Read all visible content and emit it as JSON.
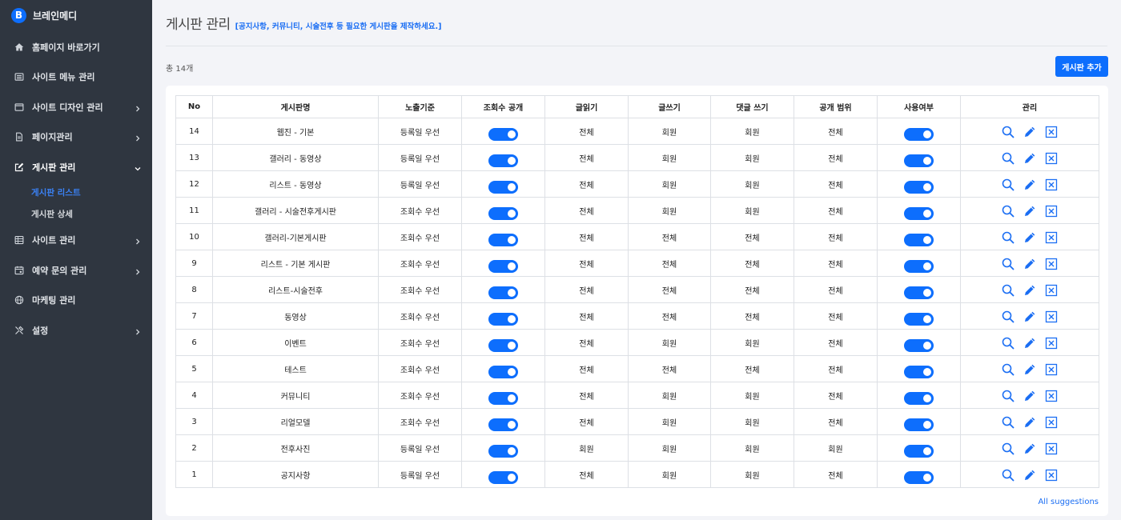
{
  "brand": {
    "logo_letter": "B",
    "name": "브레인메디"
  },
  "sidebar": {
    "items": [
      {
        "label": "홈페이지 바로가기",
        "icon": "home-icon",
        "chevron": false
      },
      {
        "label": "사이트 메뉴 관리",
        "icon": "list-icon",
        "chevron": false
      },
      {
        "label": "사이트 디자인 관리",
        "icon": "window-icon",
        "chevron": true
      },
      {
        "label": "페이지관리",
        "icon": "document-icon",
        "chevron": true
      },
      {
        "label": "게시판 관리",
        "icon": "edit-icon",
        "chevron": true,
        "expanded": true
      },
      {
        "label": "사이트 관리",
        "icon": "grid-icon",
        "chevron": true
      },
      {
        "label": "예약 문의 관리",
        "icon": "calendar-icon",
        "chevron": true
      },
      {
        "label": "마케팅 관리",
        "icon": "globe-icon",
        "chevron": false
      },
      {
        "label": "설정",
        "icon": "tools-icon",
        "chevron": true
      }
    ],
    "submenu": [
      "게시판 리스트",
      "게시판 상세"
    ]
  },
  "header": {
    "title": "게시판 관리",
    "description": "[공지사항, 커뮤니티, 시술전후 등 필요한 게시판을 제작하세요.]"
  },
  "toolbar": {
    "total": "총 14개",
    "add_label": "게시판 추가"
  },
  "table": {
    "columns": [
      "No",
      "게시판명",
      "노출기준",
      "조회수 공개",
      "글읽기",
      "글쓰기",
      "댓글 쓰기",
      "공개 범위",
      "사용여부",
      "관리"
    ],
    "rows": [
      {
        "no": "14",
        "name": "웹진 - 기본",
        "sort": "등록일 우선",
        "read": "전체",
        "write": "회원",
        "comment": "회원",
        "scope": "전체"
      },
      {
        "no": "13",
        "name": "갤러리 - 동영상",
        "sort": "등록일 우선",
        "read": "전체",
        "write": "회원",
        "comment": "회원",
        "scope": "전체"
      },
      {
        "no": "12",
        "name": "리스트 - 동영상",
        "sort": "등록일 우선",
        "read": "전체",
        "write": "회원",
        "comment": "회원",
        "scope": "전체"
      },
      {
        "no": "11",
        "name": "갤러리 - 시술전후게시판",
        "sort": "조회수 우선",
        "read": "전체",
        "write": "회원",
        "comment": "회원",
        "scope": "전체"
      },
      {
        "no": "10",
        "name": "갤러리-기본게시판",
        "sort": "조회수 우선",
        "read": "전체",
        "write": "전체",
        "comment": "전체",
        "scope": "전체"
      },
      {
        "no": "9",
        "name": "리스트 - 기본 게시판",
        "sort": "조회수 우선",
        "read": "전체",
        "write": "전체",
        "comment": "전체",
        "scope": "전체"
      },
      {
        "no": "8",
        "name": "리스트-시술전후",
        "sort": "조회수 우선",
        "read": "전체",
        "write": "전체",
        "comment": "전체",
        "scope": "전체"
      },
      {
        "no": "7",
        "name": "동영상",
        "sort": "조회수 우선",
        "read": "전체",
        "write": "전체",
        "comment": "전체",
        "scope": "전체"
      },
      {
        "no": "6",
        "name": "이벤트",
        "sort": "조회수 우선",
        "read": "전체",
        "write": "회원",
        "comment": "회원",
        "scope": "전체"
      },
      {
        "no": "5",
        "name": "테스트",
        "sort": "조회수 우선",
        "read": "전체",
        "write": "전체",
        "comment": "전체",
        "scope": "전체"
      },
      {
        "no": "4",
        "name": "커뮤니티",
        "sort": "조회수 우선",
        "read": "전체",
        "write": "회원",
        "comment": "회원",
        "scope": "전체"
      },
      {
        "no": "3",
        "name": "리얼모델",
        "sort": "조회수 우선",
        "read": "전체",
        "write": "회원",
        "comment": "회원",
        "scope": "전체"
      },
      {
        "no": "2",
        "name": "전후사진",
        "sort": "등록일 우선",
        "read": "회원",
        "write": "회원",
        "comment": "회원",
        "scope": "회원"
      },
      {
        "no": "1",
        "name": "공지사항",
        "sort": "등록일 우선",
        "read": "전체",
        "write": "회원",
        "comment": "회원",
        "scope": "전체"
      }
    ],
    "toggle_state": "on",
    "action_icons": [
      "search-icon",
      "pencil-icon",
      "close-box-icon"
    ]
  },
  "footer": {
    "link": "All suggestions"
  },
  "colors": {
    "accent": "#0d6efd",
    "sidebar_bg": "#2f3640",
    "submenu_active": "#3b82f6"
  }
}
